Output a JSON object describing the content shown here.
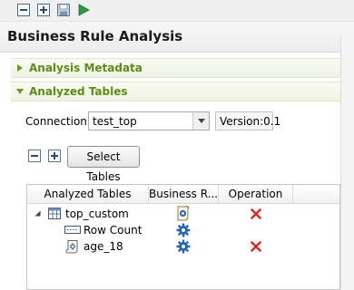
{
  "toolbar": {
    "buttons": [
      "collapse-all-icon",
      "expand-all-icon",
      "save-icon",
      "run-icon"
    ]
  },
  "editor": {
    "title": "Business Rule Analysis"
  },
  "sections": {
    "metadata_label": "Analysis Metadata",
    "tables_label": "Analyzed Tables"
  },
  "connection": {
    "label": "Connection:",
    "value": "test_top",
    "version": "Version:0.1"
  },
  "select_tables_label": "Select Tables",
  "table": {
    "columns": [
      "Analyzed Tables",
      "Business R...",
      "Operation"
    ],
    "rows": [
      {
        "name": "top_custom",
        "icon": "table-icon",
        "has_rule_icon": true,
        "rule_icon": "business-rule-icon",
        "delete": true
      },
      {
        "name": "Row Count",
        "icon": "row-count-icon",
        "has_rule_icon": true,
        "rule_icon": "gear-icon",
        "delete": false
      },
      {
        "name": "age_18",
        "icon": "rule-scroll-icon",
        "has_rule_icon": true,
        "rule_icon": "gear-icon",
        "delete": true
      }
    ]
  },
  "colors": {
    "section_header_text": "#5e8c17",
    "delete_red": "#d92b2b",
    "gear_blue": "#2a64b5"
  }
}
